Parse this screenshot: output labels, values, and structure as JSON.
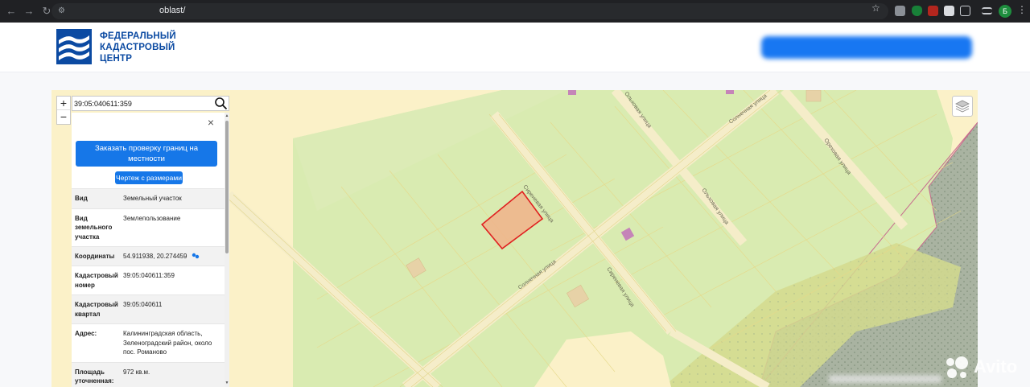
{
  "browser": {
    "url": "oblast/",
    "profile_letter": "Б"
  },
  "header": {
    "logo_line1": "ФЕДЕРАЛЬНЫЙ",
    "logo_line2": "КАДАСТРОВЫЙ",
    "logo_line3": "ЦЕНТР"
  },
  "map": {
    "search_value": "39:05:040611:359",
    "zoom_in": "+",
    "zoom_out": "−",
    "streets": {
      "sirenevaya_1": "Сиреневая улица",
      "sirenevaya_2": "Сиреневая улица",
      "solnechnaya_1": "Солнечная улица",
      "solnechnaya_2": "Солнечная улица",
      "olkhovaya_1": "Ольховая улица",
      "olkhovaya_2": "Ольховая улица",
      "orekhovaya": "Ореховая улица"
    }
  },
  "panel": {
    "close_symbol": "×",
    "order_button": "Заказать проверку границ на местности",
    "drawing_button": "Чертеж с размерами",
    "rows": [
      {
        "key": "Вид",
        "value": "Земельный участок"
      },
      {
        "key": "Вид земельного участка",
        "value": "Землепользование"
      },
      {
        "key": "Координаты",
        "value": "54.911938, 20.274459"
      },
      {
        "key": "Кадастровый номер",
        "value": "39:05:040611:359"
      },
      {
        "key": "Кадастровый квартал",
        "value": "39:05:040611"
      },
      {
        "key": "Адрес:",
        "value": "Калининградская область, Зеленоградский район, около пос. Романово"
      },
      {
        "key": "Площадь уточненная:",
        "value": "972 кв.м."
      }
    ]
  },
  "watermark": {
    "text": "Avito"
  }
}
